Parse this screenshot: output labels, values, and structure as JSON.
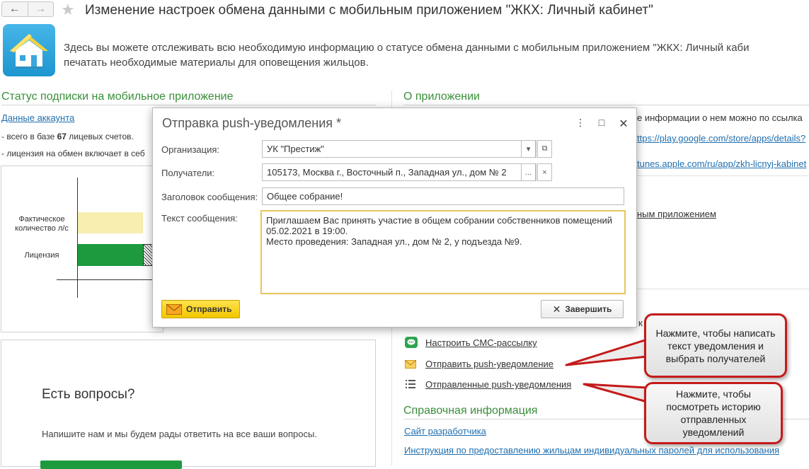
{
  "header": {
    "title": "Изменение настроек обмена данными с мобильным приложением \"ЖКХ: Личный кабинет\"",
    "back_icon": "arrow-left-icon",
    "forward_icon": "arrow-right-icon",
    "favorite_icon": "star-icon"
  },
  "intro": {
    "line1": "Здесь вы можете отслеживать всю необходимую информацию о статусе обмена данными с мобильным приложением \"ЖКХ: Личный каби",
    "line2": "печатать необходимые материалы для оповещения жильцов."
  },
  "left": {
    "section_title": "Статус подписки на мобильное приложение",
    "account_link": "Данные аккаунта",
    "stat_prefix": "- всего в базе ",
    "stat_count": "67",
    "stat_suffix": " лицевых счетов.",
    "license_text": "- лицензия на обмен включает в себ",
    "chart": {
      "bar1_label": "Фактическое количество л/с",
      "bar2_label": "Лицензия"
    },
    "questions_title": "Есть вопросы?",
    "questions_text": "Напишите нам и мы будем рады ответить на все ваши вопросы."
  },
  "right": {
    "section_title": "О приложении",
    "info_text": "е информации о нем можно по ссылка",
    "google_link": "ttps://play.google.com/store/apps/details?",
    "apple_link": "tunes.apple.com/ru/app/zkh-licnyj-kabinet",
    "app_link": "ным приложением",
    "links": [
      {
        "icon": "sms-icon",
        "label": "Настроить СМС-рассылку"
      },
      {
        "icon": "envelope-icon",
        "label": "Отправить push-уведомление"
      },
      {
        "icon": "list-icon",
        "label": "Отправленные push-уведомления"
      }
    ],
    "reference_title": "Справочная информация",
    "dev_site_link": "Сайт разработчика",
    "instruction_link": "Инструкция по предоставлению жильцам индивидуальных паролей для использования"
  },
  "dialog": {
    "title": "Отправка push-уведомления *",
    "org_label": "Организация:",
    "org_value": "УК \"Престиж\"",
    "recipients_label": "Получатели:",
    "recipients_value": "105173, Москва г., Восточный п., Западная ул., дом № 2",
    "subject_label": "Заголовок сообщения:",
    "subject_value": "Общее собрание!",
    "text_label": "Текст сообщения:",
    "text_value": "Приглашаем Вас принять участие в общем собрании собственников помещений\n05.02.2021 в 19:00.\nМесто проведения: Западная ул., дом № 2, у подъезда №9.",
    "send_button": "Отправить",
    "finish_button": "Завершить"
  },
  "callouts": {
    "first": "Нажмите, чтобы написать текст уведомления и выбрать получателей",
    "second": "Нажмите, чтобы посмотреть историю отправленных уведомлений"
  },
  "colors": {
    "section_green": "#3a8f3a",
    "bar_fact": "#f7eeb0",
    "bar_license": "#1e9a3e",
    "accent_yellow": "#f3c600",
    "callout_border": "#c41a1a"
  }
}
